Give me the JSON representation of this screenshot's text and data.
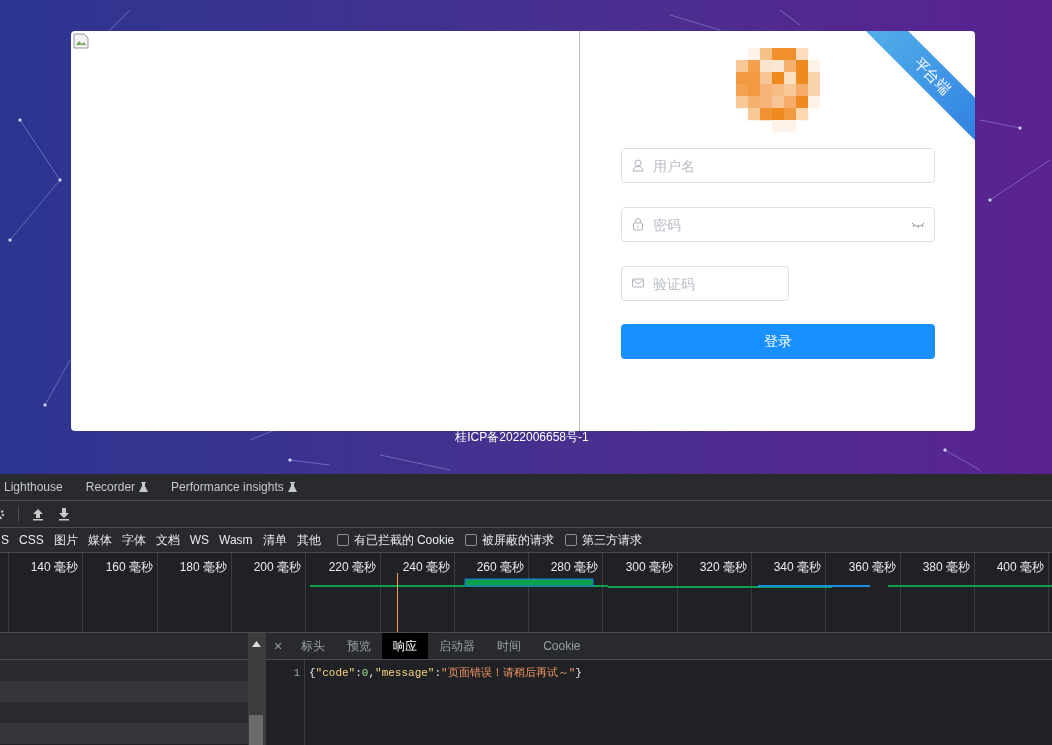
{
  "login_card": {
    "ribbon": "平台端",
    "fields": [
      {
        "kind": "user",
        "placeholder": "用户名"
      },
      {
        "kind": "password",
        "placeholder": "密码"
      },
      {
        "kind": "captcha",
        "placeholder": "验证码"
      }
    ],
    "submit": "登录"
  },
  "footer": "桂ICP备2022006658号-1",
  "devtools": {
    "tabs": [
      {
        "label": "Lighthouse",
        "experimental": false
      },
      {
        "label": "Recorder",
        "experimental": true
      },
      {
        "label": "Performance insights",
        "experimental": true
      }
    ],
    "filters": [
      "S",
      "CSS",
      "图片",
      "媒体",
      "字体",
      "文档",
      "WS",
      "Wasm",
      "清单",
      "其他"
    ],
    "checkboxes": [
      {
        "label": "有已拦截的 Cookie",
        "checked": false
      },
      {
        "label": "被屏蔽的请求",
        "checked": false
      },
      {
        "label": "第三方请求",
        "checked": false
      }
    ],
    "timeline_ticks": [
      "140 毫秒",
      "160 毫秒",
      "180 毫秒",
      "200 毫秒",
      "220 毫秒",
      "240 毫秒",
      "260 毫秒",
      "280 毫秒",
      "300 毫秒",
      "320 毫秒",
      "340 毫秒",
      "360 毫秒",
      "380 毫秒",
      "400 毫秒"
    ],
    "close": "×",
    "detail_tabs": [
      {
        "label": "标头",
        "selected": false
      },
      {
        "label": "预览",
        "selected": false
      },
      {
        "label": "响应",
        "selected": true
      },
      {
        "label": "启动器",
        "selected": false
      },
      {
        "label": "时间",
        "selected": false
      },
      {
        "label": "Cookie",
        "selected": false
      }
    ],
    "code_lines": [
      {
        "number": "1",
        "tokens": [
          {
            "kind": "punct",
            "text": "{"
          },
          {
            "kind": "key",
            "text": "\"code\""
          },
          {
            "kind": "punct",
            "text": ":"
          },
          {
            "kind": "number",
            "text": "0"
          },
          {
            "kind": "punct",
            "text": ","
          },
          {
            "kind": "key",
            "text": "\"message\""
          },
          {
            "kind": "punct",
            "text": ":"
          },
          {
            "kind": "string",
            "text": "\"页面错误！请稍后再试～\""
          },
          {
            "kind": "punct",
            "text": "}"
          }
        ]
      }
    ]
  }
}
